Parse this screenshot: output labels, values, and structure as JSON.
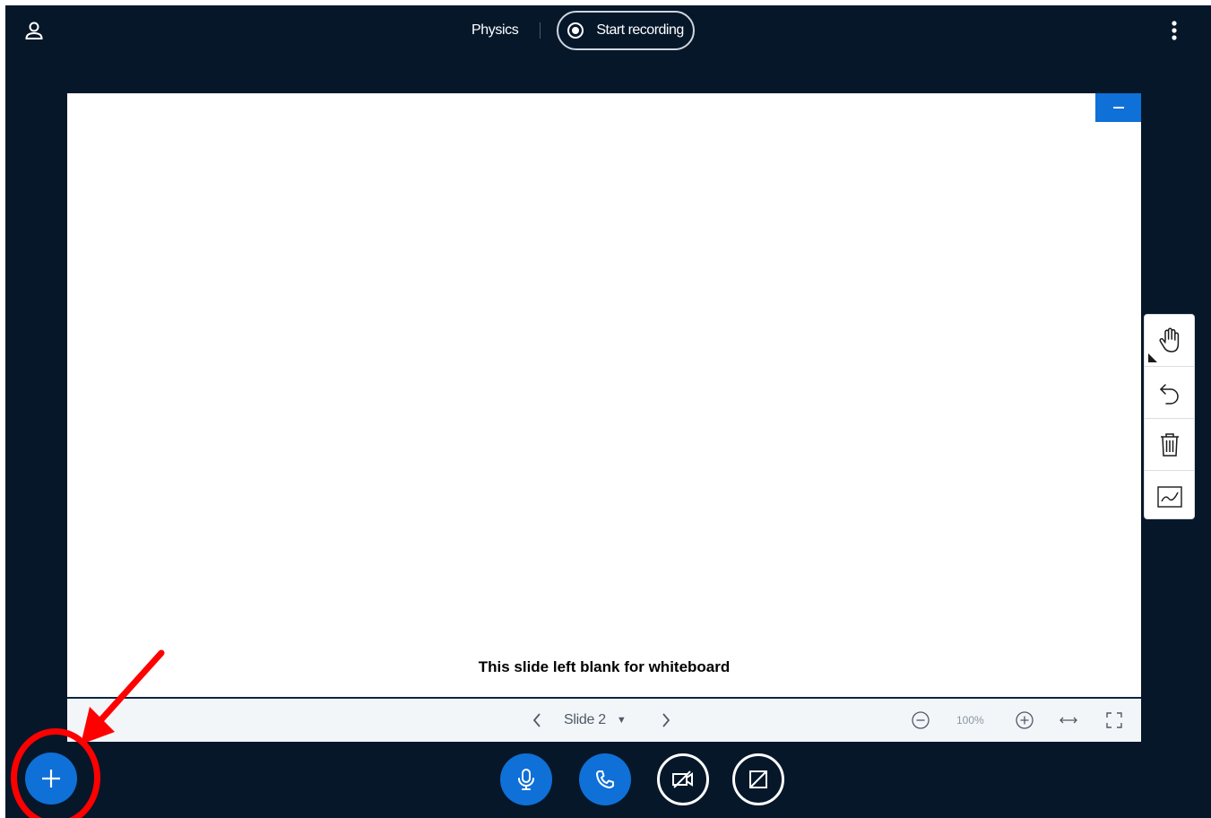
{
  "header": {
    "meeting_title": "Physics",
    "record_label": "Start recording"
  },
  "presentation": {
    "slide_caption": "This slide left blank for whiteboard",
    "toolbar": {
      "current_slide": "Slide 2",
      "zoom_level": "100%"
    }
  },
  "whiteboard_tools": [
    "hand-tool",
    "undo",
    "clear-all",
    "multi-user"
  ],
  "controls": {
    "actions": "plus-icon",
    "mic": "microphone-icon",
    "audio": "phone-icon",
    "video": "video-off-icon",
    "share": "screenshare-off-icon"
  },
  "colors": {
    "background": "#06172a",
    "accent": "#0f70d7",
    "annotation": "#ff0000"
  }
}
